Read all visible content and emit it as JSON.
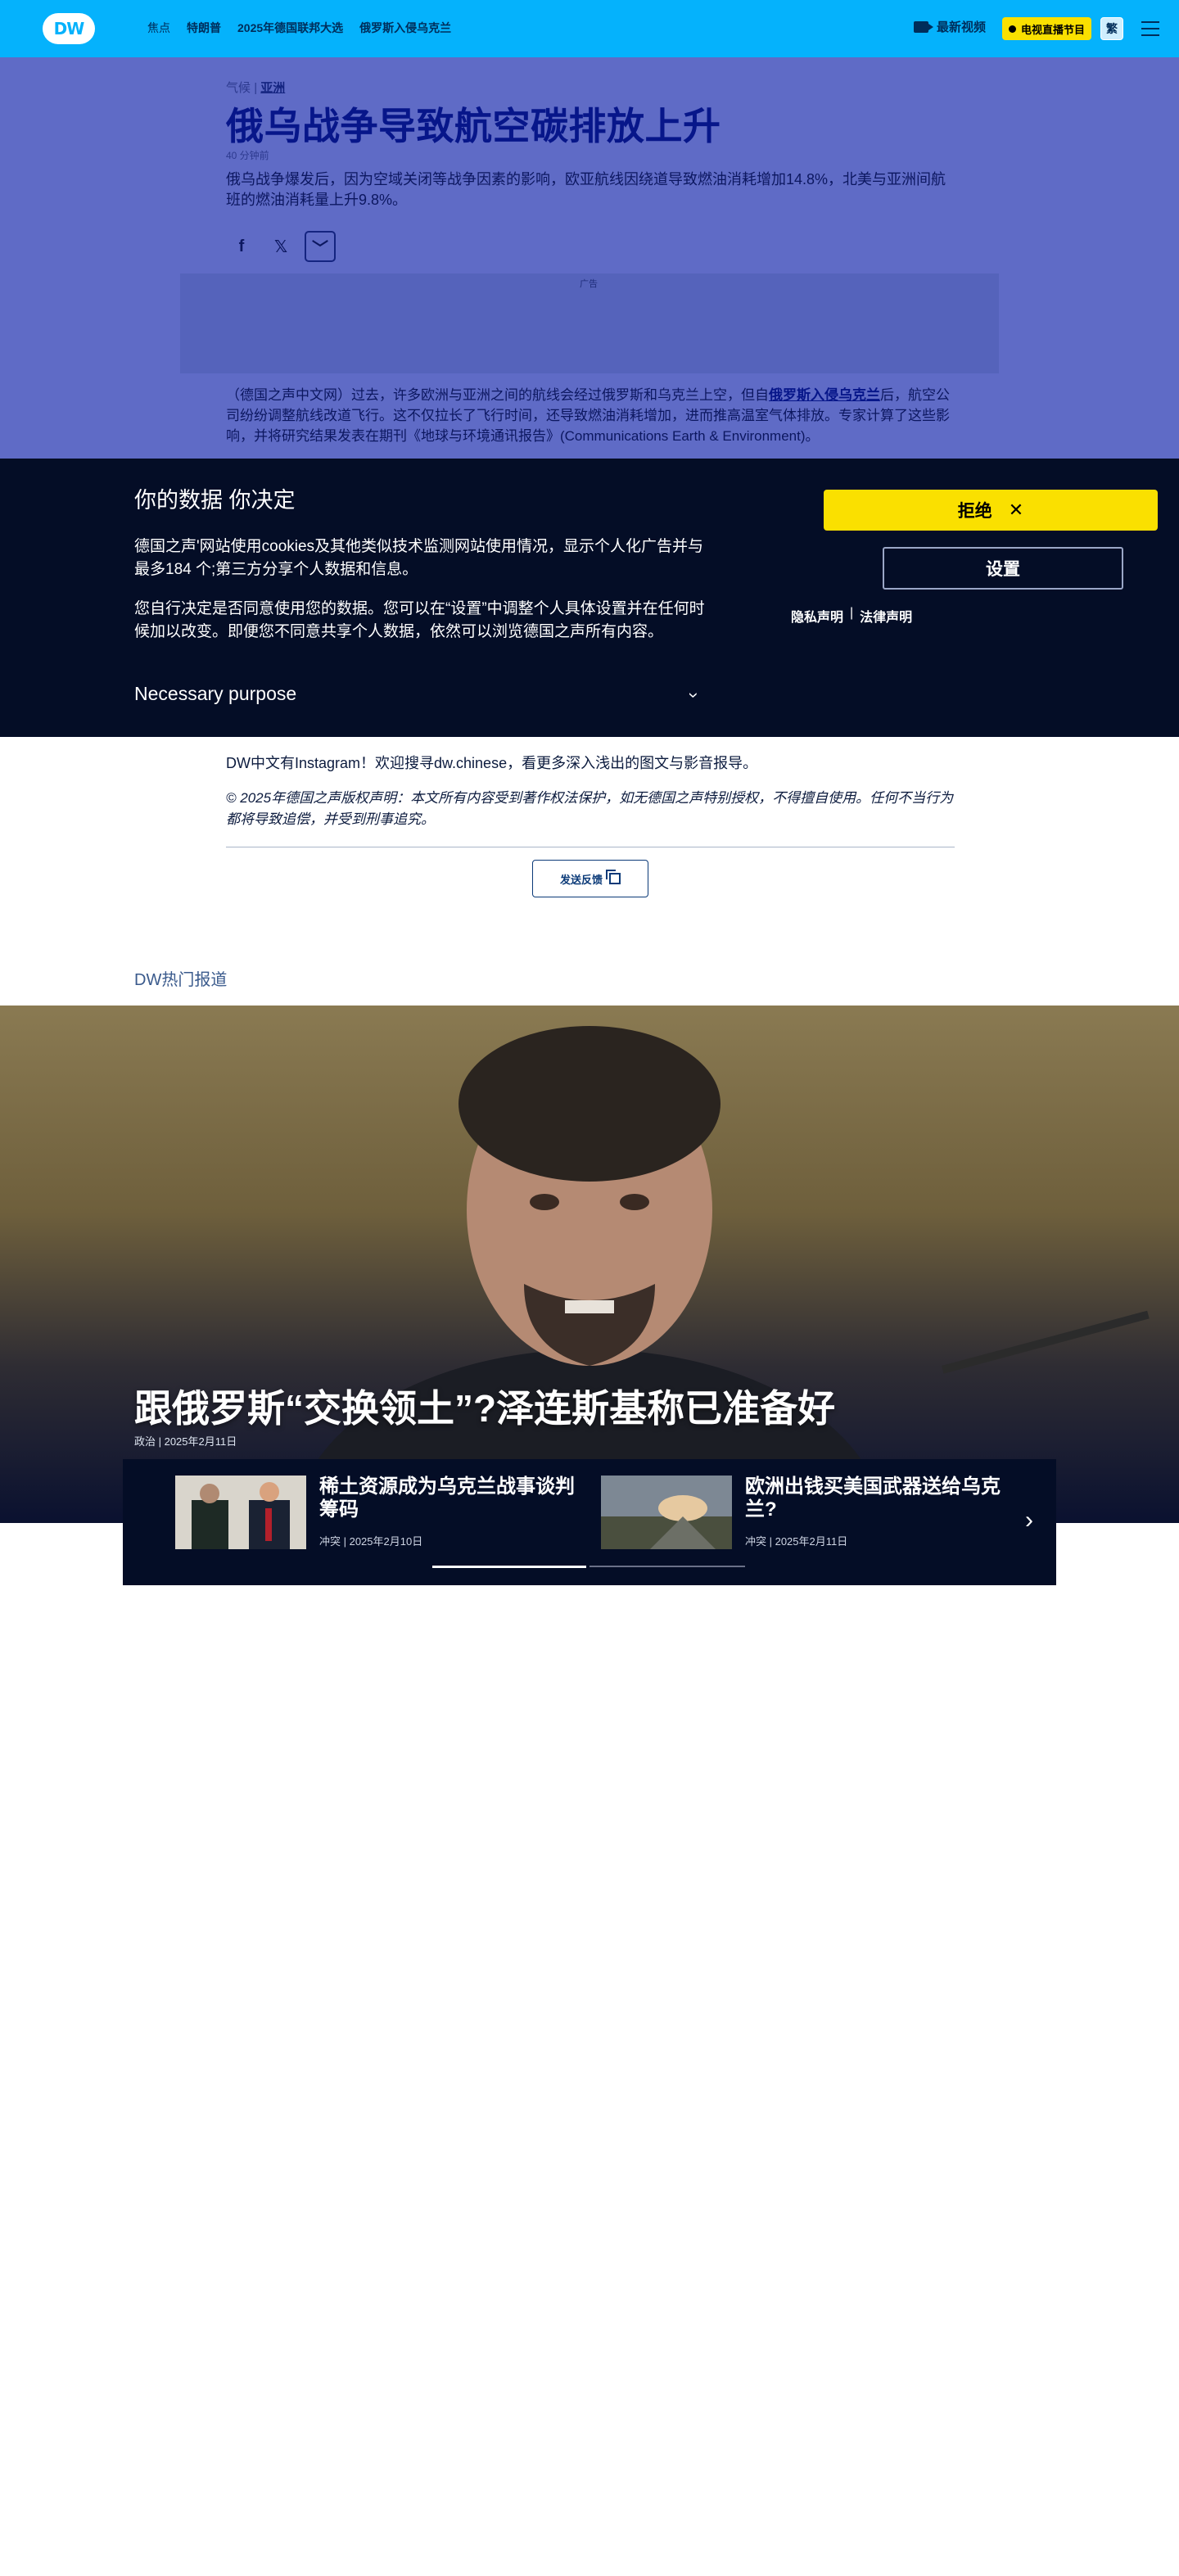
{
  "header": {
    "logo": "DW",
    "nav": [
      "焦点",
      "特朗普",
      "2025年德国联邦大选",
      "俄罗斯入侵乌克兰"
    ],
    "latest_video": "最新视频",
    "live_tv": "电视直播节目",
    "traditional": "繁"
  },
  "article": {
    "category": "气候",
    "region": "亚洲",
    "separator": "|",
    "title": "俄乌战争导致航空碳排放上升",
    "time": "40 分钟前",
    "lead": "俄乌战争爆发后，因为空域关闭等战争因素的影响，欧亚航线因绕道导致燃油消耗增加14.8%，北美与亚洲间航班的燃油消耗量上升9.8%。",
    "ad_label": "广告",
    "body_prefix": "（德国之声中文网）过去，许多欧洲与亚洲之间的航线会经过俄罗斯和乌克兰上空，但自",
    "body_link": "俄罗斯入侵乌克兰",
    "body_suffix": "后，航空公司纷纷调整航线改道飞行。这不仅拉长了飞行时间，还导致燃油消耗增加，进而推高温室气体排放。专家计算了这些影响，并将研究结果发表在期刊《地球与环境通讯报告》(Communications Earth & Environment)。"
  },
  "cookie": {
    "title": "你的数据 你决定",
    "p1": "德国之声'网站使用cookies及其他类似技术监测网站使用情况，显示个人化广告并与最多184 个;第三方分享个人数据和信息。",
    "p2": "您自行决定是否同意使用您的数据。您可以在“设置”中调整个人具体设置并在任何时候加以改变。即便您不同意共享个人数据，依然可以浏览德国之声所有内容。",
    "purpose": "Necessary purpose",
    "reject": "拒绝",
    "settings": "设置",
    "privacy": "隐私声明",
    "legal": "法律声明",
    "link_sep": "|"
  },
  "footer_article": {
    "instagram": "DW中文有Instagram！欢迎搜寻dw.chinese，看更多深入浅出的图文与影音报导。",
    "copyright": "© 2025年德国之声版权声明：本文所有内容受到著作权法保护，如无德国之声特别授权，不得擅自使用。任何不当行为都将导致追偿，并受到刑事追究。",
    "feedback": "发送反馈"
  },
  "hot": {
    "heading": "DW热门报道",
    "hero_title": "跟俄罗斯“交换领土”?泽连斯基称已准备好",
    "hero_meta": "政治  |  2025年2月11日",
    "cards": [
      {
        "title": "稀土资源成为乌克兰战事谈判筹码",
        "meta": "冲突  |  2025年2月10日"
      },
      {
        "title": "欧洲出钱买美国武器送给乌克兰?",
        "meta": "冲突  |  2025年2月11日"
      }
    ]
  }
}
